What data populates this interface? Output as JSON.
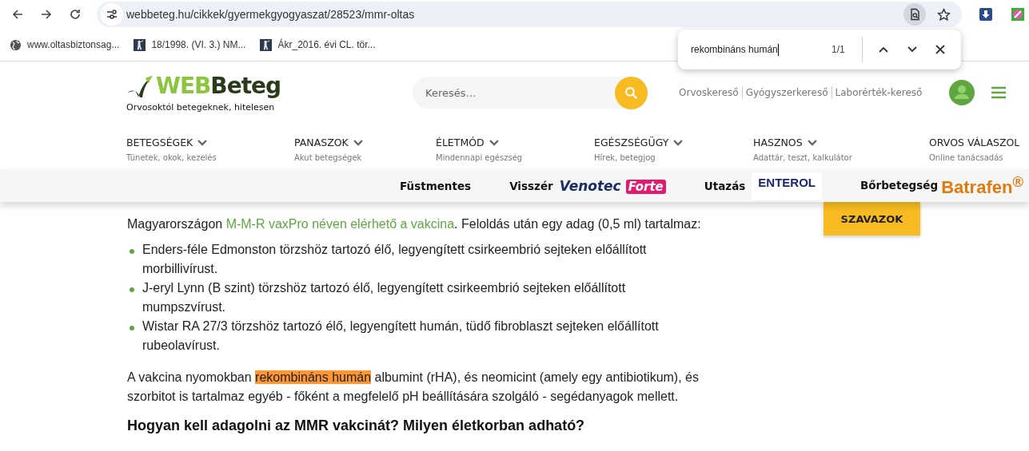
{
  "browser": {
    "url": "webbeteg.hu/cikkek/gyermekgyogyaszat/28523/mmr-oltas",
    "bookmarks": [
      {
        "label": "www.oltasbiztonsag...",
        "kind": "globe"
      },
      {
        "label": "18/1998. (VI. 3.) NM...",
        "kind": "page"
      },
      {
        "label": "Ákr_2016. évi CL. tör...",
        "kind": "page"
      }
    ]
  },
  "find_bar": {
    "value": "rekombináns humán",
    "count": "1/1"
  },
  "site": {
    "logo_web": "WEB",
    "logo_beteg": "Beteg",
    "tagline": "Orvosoktól betegeknek, hitelesen",
    "search": {
      "placeholder": "Keresés…"
    },
    "quick_links": [
      "Orvoskereső",
      "Gyógyszerkereső",
      "Laborérték-kereső"
    ],
    "nav": [
      {
        "label": "BETEGSÉGEK",
        "sub": "Tünetek, okok, kezelés",
        "dropdown": true
      },
      {
        "label": "PANASZOK",
        "sub": "Akut betegségek",
        "dropdown": true
      },
      {
        "label": "ÉLETMÓD",
        "sub": "Mindennapi egészség",
        "dropdown": true
      },
      {
        "label": "EGÉSZSÉGÜGY",
        "sub": "Hírek, betegjog",
        "dropdown": true
      },
      {
        "label": "HASZNOS",
        "sub": "Adattár, teszt, kalkulátor",
        "dropdown": true
      },
      {
        "label": "ORVOS VÁLASZOL",
        "sub": "Online tanácsadás",
        "dropdown": false
      }
    ],
    "promo_bar": [
      {
        "label": "Füstmentes",
        "kind": "plain"
      },
      {
        "label": "Visszér",
        "kind": "venotec",
        "brand": "Venotec",
        "brand_tag": "Forte"
      },
      {
        "label": "Utazás",
        "kind": "enterol",
        "brand": "ENTEROL"
      },
      {
        "label": "Bőrbetegség",
        "kind": "batrafen",
        "brand": "Batrafen$^{®}$"
      }
    ]
  },
  "vote_button": "SZAVAZOK",
  "article": {
    "intro": [
      {
        "kind": "text",
        "text": "Magyarországon "
      },
      {
        "kind": "link",
        "text": "M-M-R vaxPro néven elérhető a vakcina"
      },
      {
        "kind": "text",
        "text": ". Feloldás után egy adag (0,5 ml) tartalmaz:"
      }
    ],
    "bullets": [
      "Enders-féle Edmonston törzshöz tartozó élő, legyengített csirkeembrió sejteken előállított morbillivírust.",
      "J-eryl Lynn (B szint) törzshöz tartozó élő, legyengített csirkeembrió sejteken előállított mumpszvírust.",
      "Wistar RA 27/3 törzshöz tartozó élő, legyengített humán, tüdő fibroblaszt sejteken előállított rubeolavírust."
    ],
    "paragraph": [
      {
        "kind": "text",
        "text": "A vakcina nyomokban "
      },
      {
        "kind": "highlight",
        "text": "rekombináns humán"
      },
      {
        "kind": "text",
        "text": " albumint (rHA), és neomicint (amely egy antibiotikum), és szorbitot is tartalmaz egyéb - főként a megfelelő pH beállítására szolgáló - segédanyagok mellett."
      }
    ],
    "heading": "Hogyan kell adagolni az MMR vakcinát? Milyen életkorban adható?"
  }
}
